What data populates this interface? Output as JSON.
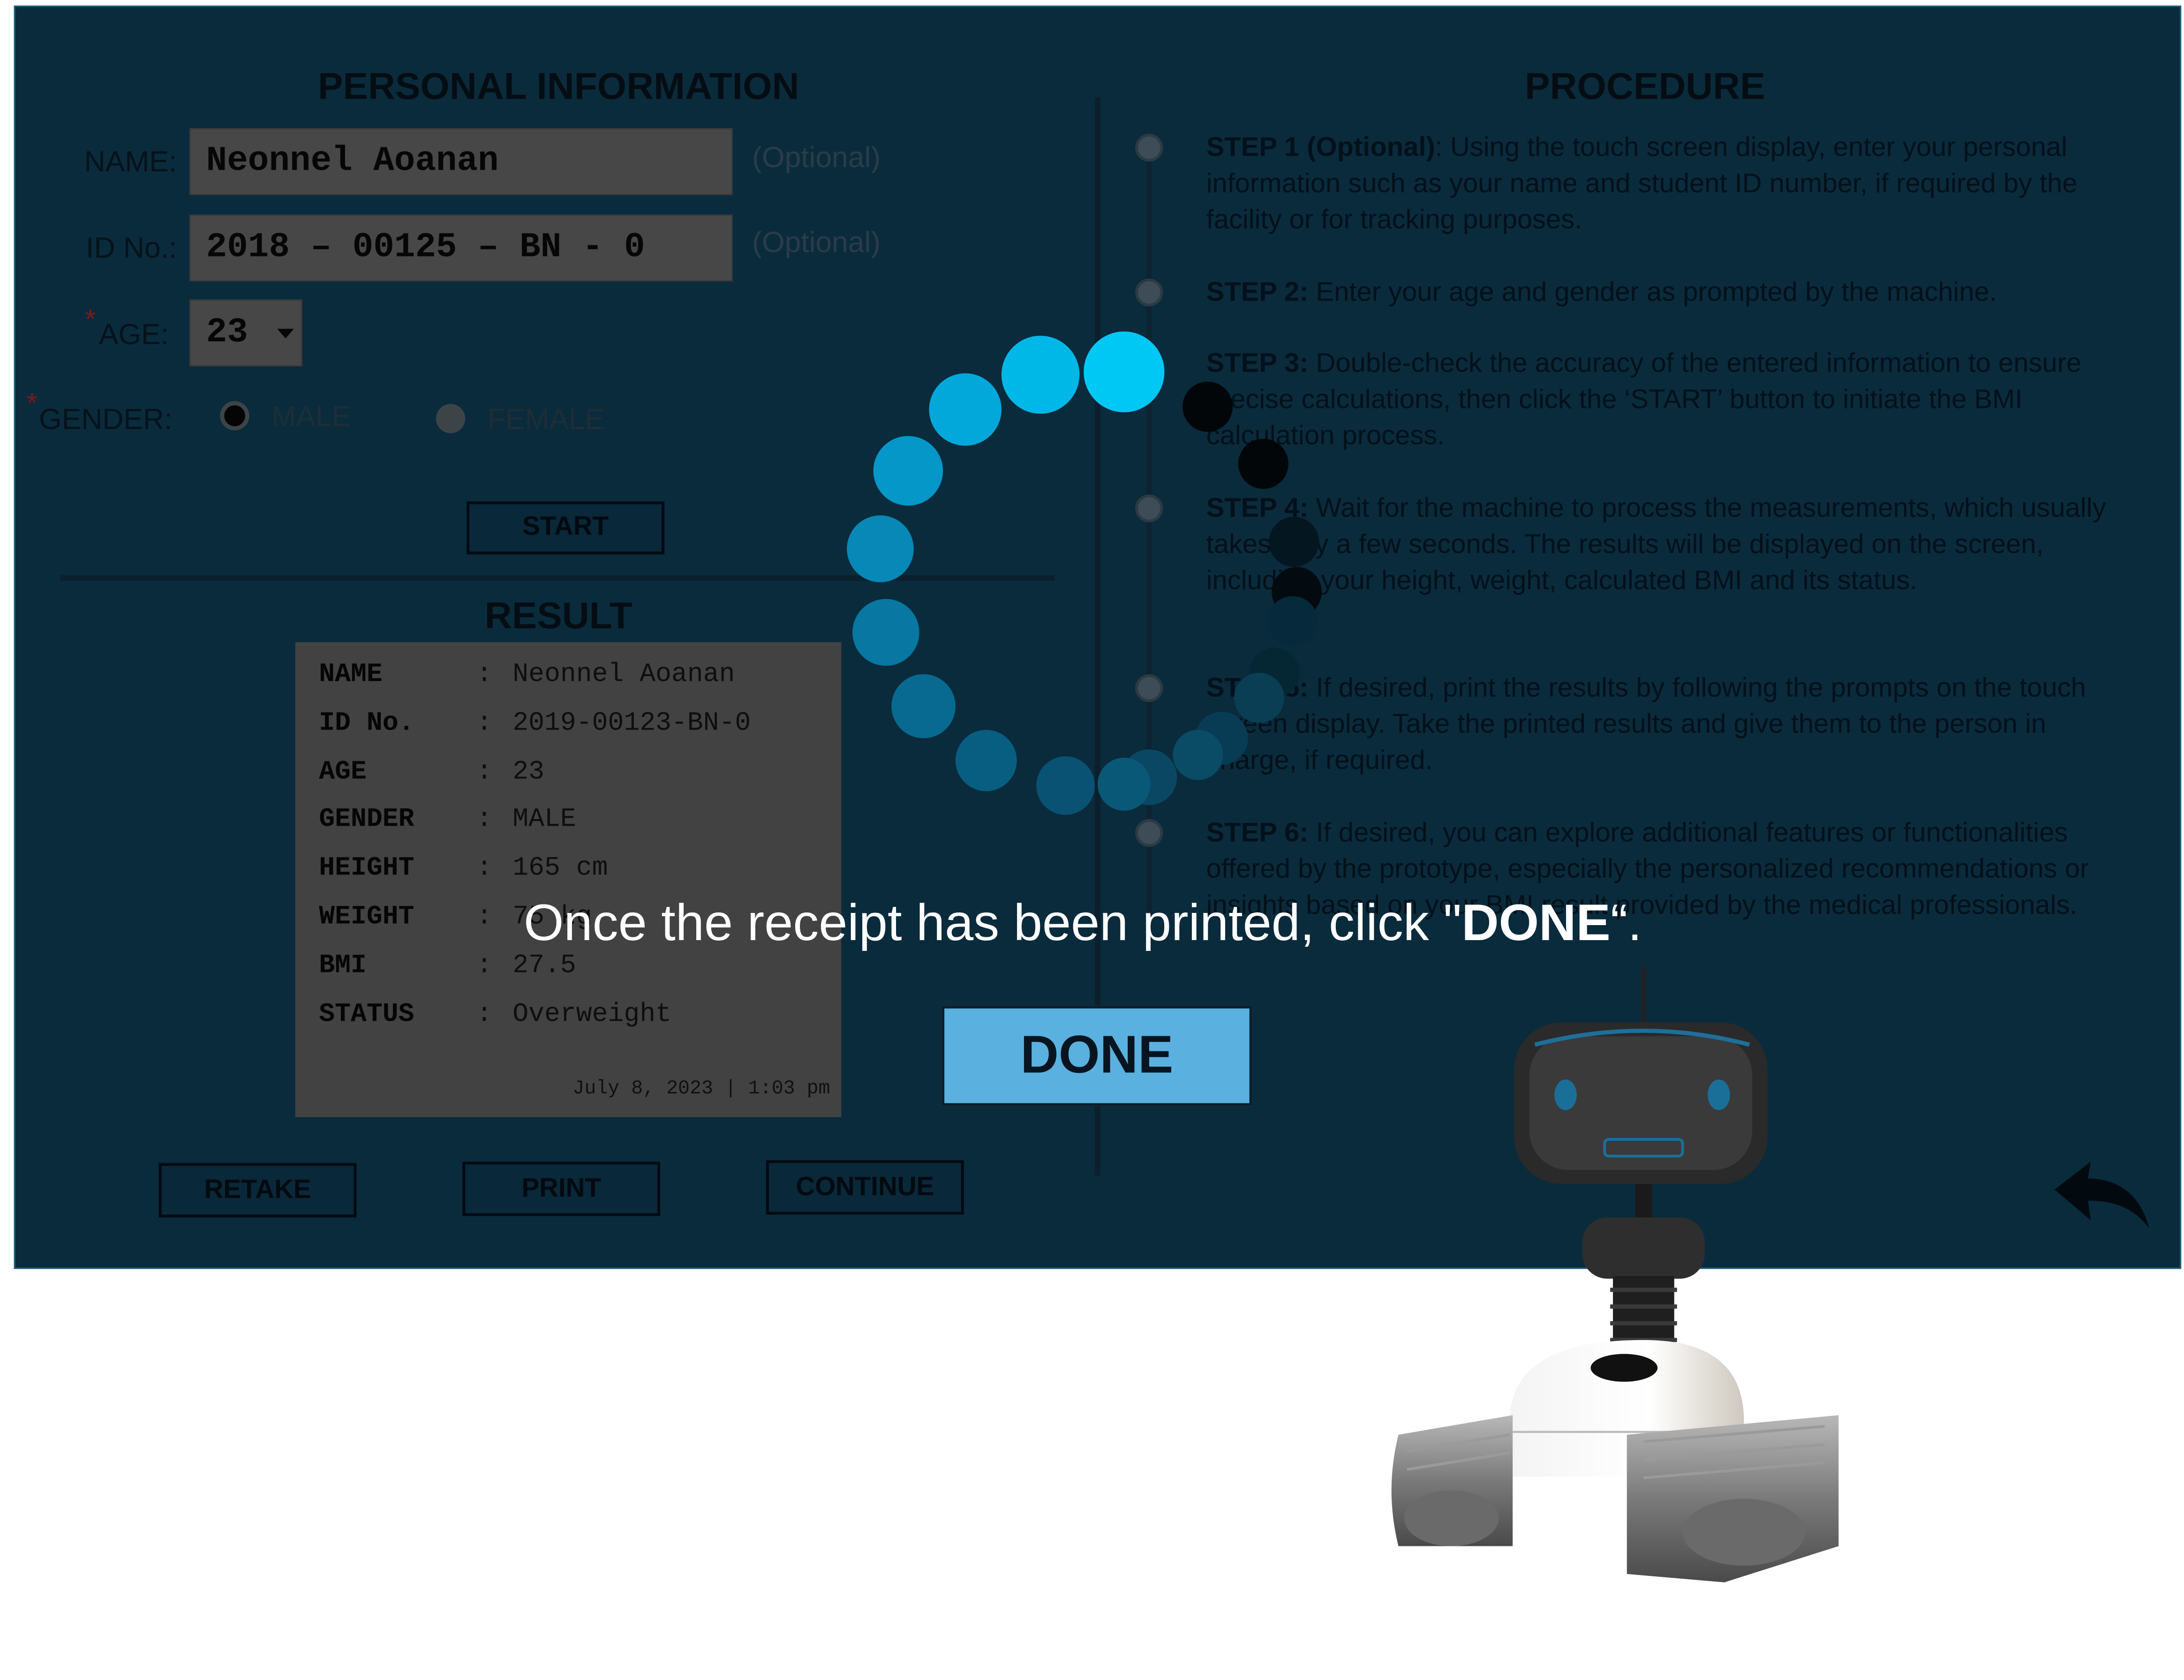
{
  "personal_info": {
    "heading": "PERSONAL INFORMATION",
    "name_label": "NAME:",
    "name_value": "Neonnel Aoanan",
    "name_hint": "(Optional)",
    "id_label": "ID No.:",
    "id_value": "2018 – 00125 – BN - 0",
    "id_hint": "(Optional)",
    "age_required_mark": "*",
    "age_label": "AGE:",
    "age_value": "23",
    "gender_required_mark": "*",
    "gender_label": "GENDER:",
    "gender_options": [
      "MALE",
      "FEMALE"
    ],
    "gender_selected": "MALE",
    "start_label": "START"
  },
  "result": {
    "heading": "RESULT",
    "rows": [
      {
        "key": "NAME",
        "value": "Neonnel Aoanan"
      },
      {
        "key": "ID No.",
        "value": "2019-00123-BN-0"
      },
      {
        "key": "AGE",
        "value": "23"
      },
      {
        "key": "GENDER",
        "value": "MALE"
      },
      {
        "key": "HEIGHT",
        "value": "165 cm"
      },
      {
        "key": "WEIGHT",
        "value": "75 kg"
      },
      {
        "key": "BMI",
        "value": "27.5"
      },
      {
        "key": "STATUS",
        "value": "Overweight"
      }
    ],
    "separator": ":",
    "timestamp": "July 8, 2023 | 1:03 pm"
  },
  "actions": {
    "retake": "RETAKE",
    "print": "PRINT",
    "continue": "CONTINUE"
  },
  "procedure": {
    "heading": "PROCEDURE",
    "steps": [
      {
        "title": "STEP 1 (Optional)",
        "text": ": Using the touch screen display, enter your personal information such as your name and student ID number, if required by the facility or for tracking purposes."
      },
      {
        "title": "STEP 2:",
        "text": " Enter your age and gender as prompted by the machine."
      },
      {
        "title": "STEP 3:",
        "text": " Double-check the accuracy of the entered information to ensure precise calculations, then click the ‘START’ button to initiate the BMI calculation process."
      },
      {
        "title": "STEP 4:",
        "text": " Wait for the machine to process the measurements, which usually takes only a few seconds. The results will be displayed on the screen, including your height, weight, calculated BMI and its status."
      },
      {
        "title": "STEP 5:",
        "text": " If desired, print the results by following the prompts on the touch screen display. Take the printed results and give them to the person in charge, if required."
      },
      {
        "title": "STEP 6:",
        "text": " If desired, you can explore additional features or functionalities offered by the prototype, especially the personalized recommendations or insights based on your BMI result provided by the medical professionals."
      }
    ]
  },
  "overlay": {
    "message_before": "Once the receipt has been printed, click \"",
    "message_bold": "DONE",
    "message_after": "“.",
    "done_label": "DONE"
  },
  "icons": {
    "back": "back-arrow-icon",
    "spinner": "loading-spinner-icon",
    "dropdown": "caret-down-icon",
    "mascot": "robot-mascot"
  },
  "colors": {
    "screen_bg": "#0a2b3c",
    "accent": "#5ab1df",
    "spinner": "#00c8f5"
  }
}
